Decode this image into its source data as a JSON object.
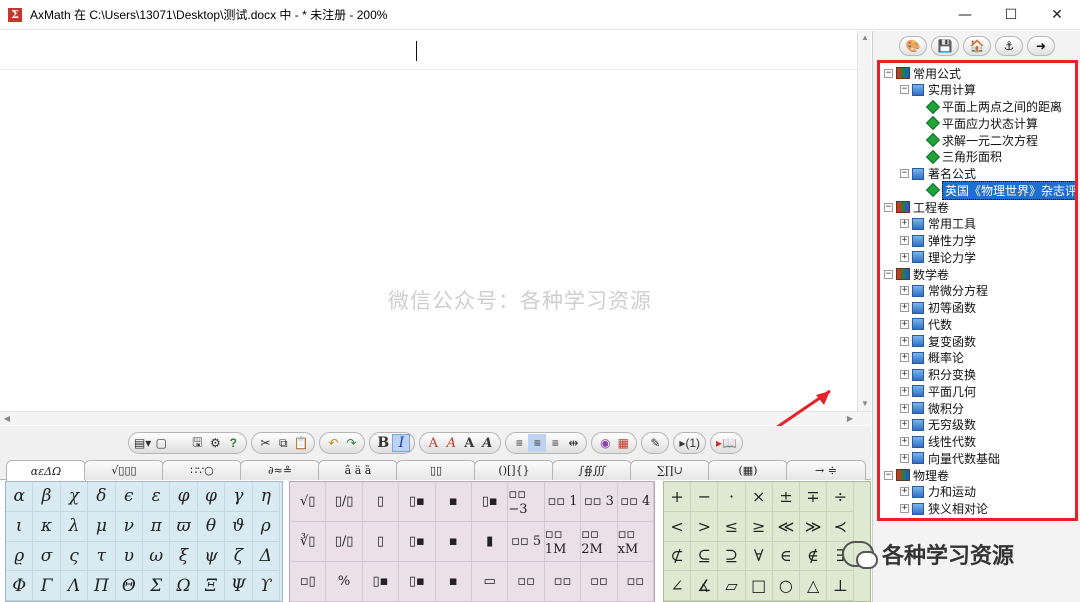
{
  "window": {
    "title": "AxMath 在 C:\\Users\\13071\\Desktop\\测试.docx 中 - * 未注册 - 200%",
    "minimize": "—",
    "maximize": "☐",
    "close": "✕"
  },
  "editor": {
    "watermark": "微信公众号：各种学习资源"
  },
  "tree": {
    "groups": [
      {
        "label": "常用公式",
        "children": [
          {
            "label": "实用计算",
            "items": [
              "平面上两点之间的距离",
              "平面应力状态计算",
              "求解一元二次方程",
              "三角形面积"
            ]
          },
          {
            "label": "著名公式",
            "items": [
              "英国《物理世界》杂志评"
            ]
          }
        ]
      },
      {
        "label": "工程卷",
        "children": [
          {
            "label": "常用工具"
          },
          {
            "label": "弹性力学"
          },
          {
            "label": "理论力学"
          }
        ]
      },
      {
        "label": "数学卷",
        "children": [
          {
            "label": "常微分方程"
          },
          {
            "label": "初等函数"
          },
          {
            "label": "代数"
          },
          {
            "label": "复变函数"
          },
          {
            "label": "概率论"
          },
          {
            "label": "积分变换"
          },
          {
            "label": "平面几何"
          },
          {
            "label": "微积分"
          },
          {
            "label": "无穷级数"
          },
          {
            "label": "线性代数"
          },
          {
            "label": "向量代数基础"
          }
        ]
      },
      {
        "label": "物理卷",
        "children": [
          {
            "label": "力和运动"
          },
          {
            "label": "狭义相对论"
          }
        ]
      }
    ]
  },
  "format_toolbar": {
    "bold": "B",
    "italic": "I",
    "font_buttons": [
      "A",
      "A",
      "A",
      "A"
    ]
  },
  "tabs": [
    "αεΔΩ",
    "√▯▯▯",
    "∷∵○",
    "∂≈≗",
    "â ä ȁ",
    "▯▯",
    "()[]{}",
    "∫∯∭",
    "∑∏∪",
    "(▦)",
    "→ ≑"
  ],
  "greek_palette": [
    [
      "α",
      "β",
      "χ",
      "δ",
      "ϵ",
      "ε",
      "φ",
      "φ",
      "γ",
      "η"
    ],
    [
      "ι",
      "κ",
      "λ",
      "μ",
      "ν",
      "π",
      "ϖ",
      "θ",
      "ϑ",
      "ρ"
    ],
    [
      "ϱ",
      "σ",
      "ς",
      "τ",
      "υ",
      "ω",
      "ξ",
      "ψ",
      "ζ",
      "Δ"
    ],
    [
      "Φ",
      "Γ",
      "Λ",
      "Π",
      "Θ",
      "Σ",
      "Ω",
      "Ξ",
      "Ψ",
      "ϒ"
    ]
  ],
  "structure_palette": [
    [
      "√▯",
      "▯/▯",
      "▯",
      "▯▪",
      "▪",
      "▯▪",
      "▫▫ −3",
      "▫▫ 1",
      "▫▫ 3",
      "▫▫ 4"
    ],
    [
      "∛▯",
      "▯/▯",
      "▯",
      "▯▪",
      "▪",
      "▮",
      "▫▫ 5",
      "▫▫ 1M",
      "▫▫ 2M",
      "▫▫ xM"
    ],
    [
      "▫▯",
      "%",
      "▯▪",
      "▯▪",
      "▪",
      "▭",
      "▫▫",
      "▫▫",
      "▫▫",
      "▫▫"
    ]
  ],
  "structure_labels": {
    "r0": [
      "",
      "",
      "",
      "",
      "",
      "",
      "−3",
      "1",
      "3",
      "4"
    ],
    "r1": [
      "",
      "",
      "",
      "",
      "",
      "",
      "5",
      "1M",
      "2M",
      "xM"
    ]
  },
  "ops_palette": [
    [
      "+",
      "−",
      "·",
      "×",
      "±",
      "∓",
      "÷"
    ],
    [
      "<",
      ">",
      "≤",
      "≥",
      "≪",
      "≫",
      "≺"
    ],
    [
      "⊄",
      "⊆",
      "⊇",
      "∀",
      "∈",
      "∉",
      "∃"
    ],
    [
      "∠",
      "∡",
      "▱",
      "□",
      "○",
      "△",
      "⊥"
    ]
  ],
  "bottom_watermark": "各种学习资源",
  "colors": {
    "highlight_border": "#e8212b",
    "selection": "#1f6fd1"
  }
}
